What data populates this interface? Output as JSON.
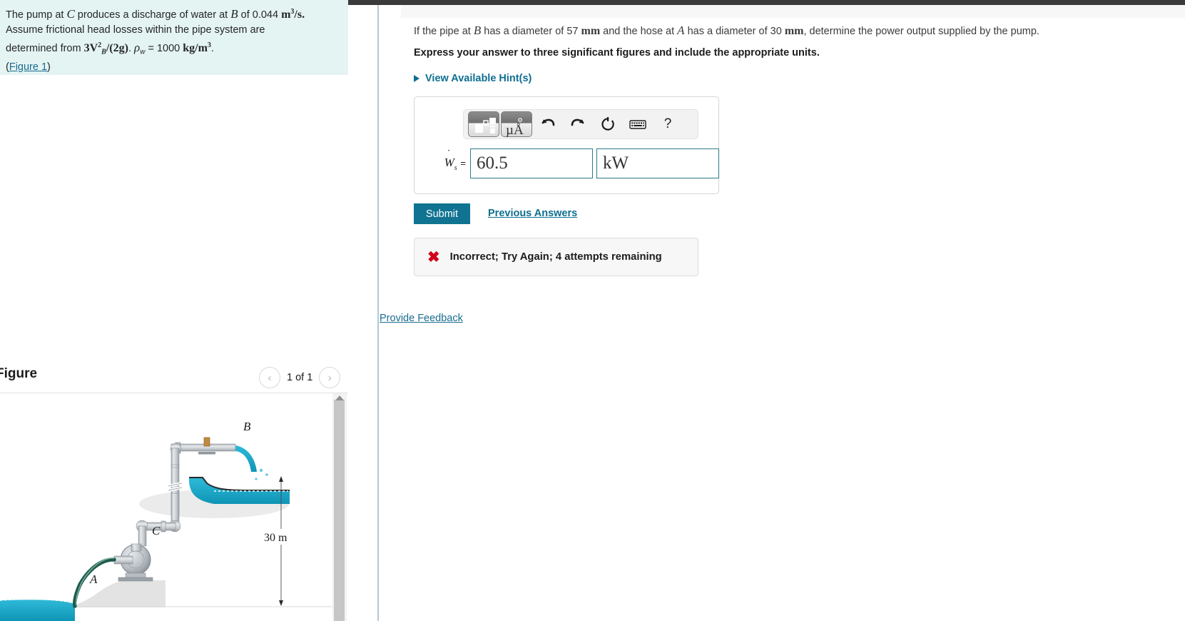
{
  "problem": {
    "line1_a": "The pump at ",
    "var_C": "C",
    "line1_b": " produces a discharge of water at ",
    "var_B": "B",
    "line1_c": " of 0.044 ",
    "unit_m3s": "m",
    "unit_m3s_sup": "3",
    "unit_m3s_rest": "/s.",
    "line2": "Assume frictional head losses within the pipe system are",
    "line3_a": "determined from ",
    "formula": "3V",
    "formula_sup": "2",
    "formula_sub": "B",
    "formula_rest": "/(2g)",
    "line3_period": ".",
    "rho_symbol": "ρ",
    "rho_sub": "w",
    "rho_value": " = 1000 ",
    "rho_unit": "kg/m",
    "rho_unit_sup": "3",
    "rho_end": ".",
    "figure_link_open": "(",
    "figure_link": "Figure 1",
    "figure_link_close": ")"
  },
  "question": {
    "prompt_a": "If the pipe at ",
    "prompt_var_B": "B",
    "prompt_b": " has a diameter of 57 ",
    "prompt_mm1": "mm",
    "prompt_c": " and the hose at ",
    "prompt_var_A": "A",
    "prompt_d": " has a diameter of 30 ",
    "prompt_mm2": "mm",
    "prompt_e": ", determine the power output supplied by the pump.",
    "instruction": "Express your answer to three significant figures and include the appropriate units."
  },
  "hints": {
    "label": "View Available Hint(s)",
    "icon": "triangle-right-icon"
  },
  "answer": {
    "equation_label": "W",
    "equation_sub": "s",
    "equation_equals": "=",
    "value": "60.5",
    "unit": "kW",
    "toolbar": {
      "template_button": "math-template-icon",
      "units_button": "μÅ",
      "undo_icon": "undo-icon",
      "redo_icon": "redo-icon",
      "reset_icon": "reset-icon",
      "keyboard_icon": "keyboard-icon",
      "help_icon": "?"
    }
  },
  "actions": {
    "submit_label": "Submit",
    "previous_answers_label": "Previous Answers"
  },
  "feedback": {
    "icon": "x-mark-icon",
    "message": "Incorrect; Try Again; 4 attempts remaining",
    "provide_feedback_label": "Provide Feedback"
  },
  "figure": {
    "title": "Figure",
    "prev_icon": "‹",
    "next_icon": "›",
    "counter": "1 of 1",
    "diagram": {
      "label_A": "A",
      "label_B": "B",
      "label_C": "C",
      "dimension": "30 m"
    }
  },
  "colors": {
    "problem_bg": "#e4f4f3",
    "accent_link": "#1a6c8f",
    "submit_bg": "#0f7391",
    "error_red": "#d0021b",
    "divider": "#b3c8d6",
    "water": "#1ea7c5"
  }
}
